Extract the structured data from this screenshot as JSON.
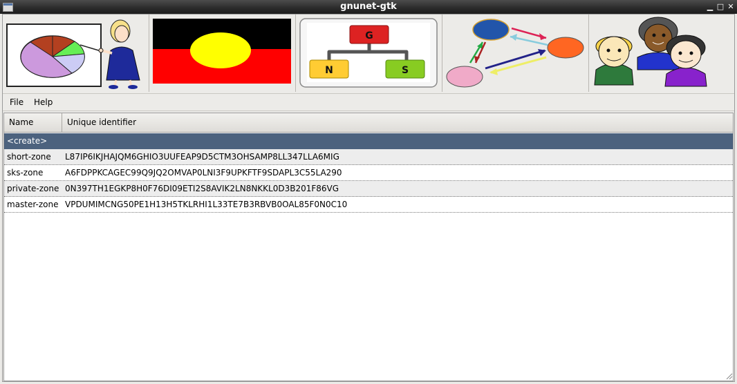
{
  "window": {
    "title": "gnunet-gtk"
  },
  "toolbar": {
    "tools": [
      {
        "name": "statistics-tool",
        "icon": "presenter-pie-chart-icon"
      },
      {
        "name": "peerinfo-tool",
        "icon": "flag-icon"
      },
      {
        "name": "gns-tool",
        "icon": "gns-tree-icon",
        "labels": [
          "G",
          "N",
          "S"
        ]
      },
      {
        "name": "fs-tool",
        "icon": "network-graph-icon"
      },
      {
        "name": "identity-tool",
        "icon": "people-icon"
      }
    ]
  },
  "menu": {
    "file": "File",
    "help": "Help"
  },
  "table": {
    "columns": [
      "Name",
      "Unique identifier"
    ],
    "rows": [
      {
        "name": "<create>",
        "id": ""
      },
      {
        "name": "short-zone",
        "id": "L87IP6IKJHAJQM6GHIO3UUFEAP9D5CTM3OHSAMP8LL347LLA6MIG"
      },
      {
        "name": "sks-zone",
        "id": "A6FDPPKCAGEC99Q9JQ2OMVAP0LNI3F9UPKFTF9SDAPL3C55LA290"
      },
      {
        "name": "private-zone",
        "id": "0N397TH1EGKP8H0F76DI09ETI2S8AVIK2LN8NKKL0D3B201F86VG"
      },
      {
        "name": "master-zone",
        "id": "VPDUMIMCNG50PE1H13H5TKLRHI1L33TE7B3RBVB0OAL85F0N0C10"
      }
    ]
  },
  "colors": {
    "selection": "#4c627e",
    "titlebar": "#2a2a2a"
  }
}
